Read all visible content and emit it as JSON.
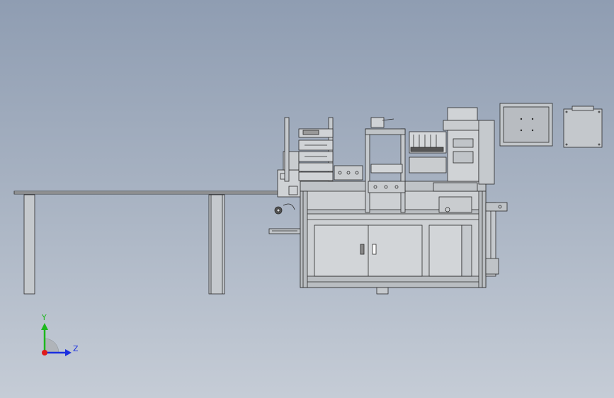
{
  "viewport": {
    "background_top": "#8f9db2",
    "background_bottom": "#c5ccd6",
    "line_color": "#2a2a2a",
    "panel_fill": "#c9cccf",
    "metal_fill": "#bfc3c7"
  },
  "triad": {
    "y_label": "Y",
    "z_label": "Z",
    "y_color": "#1db81d",
    "z_color": "#1a2fe0",
    "x_color": "#e01a1a"
  }
}
